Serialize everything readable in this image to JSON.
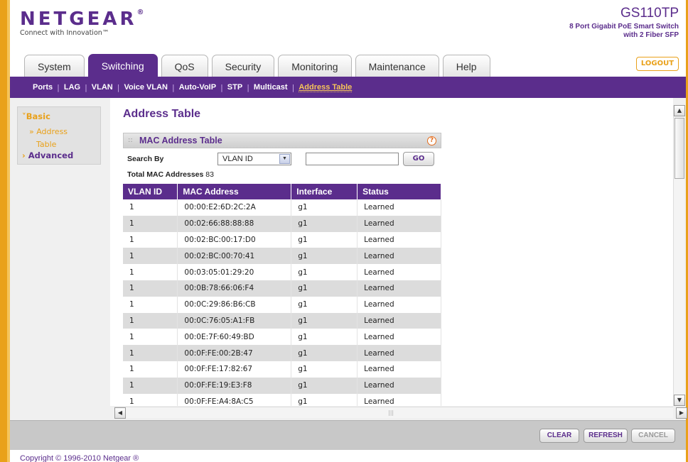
{
  "header": {
    "logo": "NETGEAR",
    "logo_mark": "®",
    "tagline": "Connect with Innovation™",
    "model": "GS110TP",
    "model_desc_1": "8 Port Gigabit PoE Smart Switch",
    "model_desc_2": "with 2 Fiber SFP",
    "logout": "LOGOUT"
  },
  "tabs": [
    "System",
    "Switching",
    "QoS",
    "Security",
    "Monitoring",
    "Maintenance",
    "Help"
  ],
  "active_tab": "Switching",
  "subnav": [
    "Ports",
    "LAG",
    "VLAN",
    "Voice VLAN",
    "Auto-VoIP",
    "STP",
    "Multicast",
    "Address Table"
  ],
  "active_subnav": "Address Table",
  "left_nav": {
    "basic": "Basic",
    "basic_sub_1": "» Address",
    "basic_sub_2": "Table",
    "advanced": "Advanced"
  },
  "main": {
    "page_title": "Address Table",
    "panel_title": "MAC Address Table",
    "help_glyph": "?",
    "search_label": "Search By",
    "search_option": "VLAN ID",
    "search_value": "",
    "go_label": "GO",
    "total_label": "Total MAC Addresses",
    "total_value": "83"
  },
  "table": {
    "columns": [
      "VLAN ID",
      "MAC Address",
      "Interface",
      "Status"
    ],
    "rows": [
      [
        "1",
        "00:00:E2:6D:2C:2A",
        "g1",
        "Learned"
      ],
      [
        "1",
        "00:02:66:88:88:88",
        "g1",
        "Learned"
      ],
      [
        "1",
        "00:02:BC:00:17:D0",
        "g1",
        "Learned"
      ],
      [
        "1",
        "00:02:BC:00:70:41",
        "g1",
        "Learned"
      ],
      [
        "1",
        "00:03:05:01:29:20",
        "g1",
        "Learned"
      ],
      [
        "1",
        "00:0B:78:66:06:F4",
        "g1",
        "Learned"
      ],
      [
        "1",
        "00:0C:29:86:B6:CB",
        "g1",
        "Learned"
      ],
      [
        "1",
        "00:0C:76:05:A1:FB",
        "g1",
        "Learned"
      ],
      [
        "1",
        "00:0E:7F:60:49:BD",
        "g1",
        "Learned"
      ],
      [
        "1",
        "00:0F:FE:00:2B:47",
        "g1",
        "Learned"
      ],
      [
        "1",
        "00:0F:FE:17:82:67",
        "g1",
        "Learned"
      ],
      [
        "1",
        "00:0F:FE:19:E3:F8",
        "g1",
        "Learned"
      ],
      [
        "1",
        "00:0F:FE:A4:8A:C5",
        "g1",
        "Learned"
      ]
    ]
  },
  "buttons": {
    "clear": "CLEAR",
    "refresh": "REFRESH",
    "cancel": "CANCEL"
  },
  "footer": {
    "copyright": "Copyright © 1996-2010 Netgear ®"
  },
  "colors": {
    "brand_purple": "#5b2d8c",
    "accent_orange": "#e9a11a"
  }
}
